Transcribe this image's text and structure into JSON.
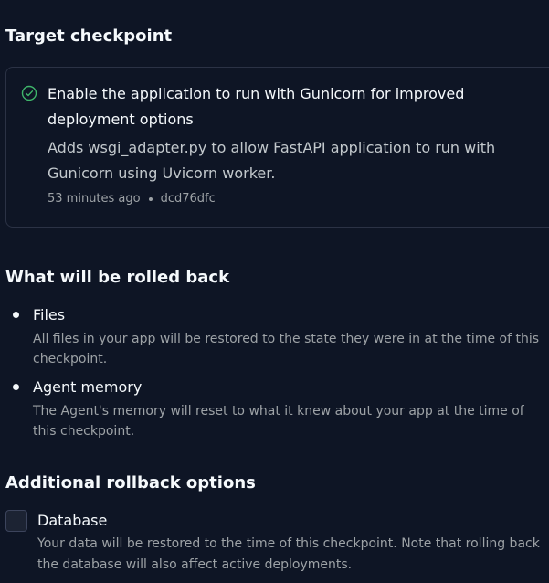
{
  "target": {
    "heading": "Target checkpoint",
    "checkpoint": {
      "title": "Enable the application to run with Gunicorn for improved deployment options",
      "description": "Adds wsgi_adapter.py to allow FastAPI application to run with Gunicorn using Uvicorn worker.",
      "time_ago": "53 minutes ago",
      "commit": "dcd76dfc",
      "icon": "check-circle-icon",
      "status_color": "#3fb56b"
    }
  },
  "rollback": {
    "heading": "What will be rolled back",
    "items": [
      {
        "title": "Files",
        "description": "All files in your app will be restored to the state they were in at the time of this checkpoint."
      },
      {
        "title": "Agent memory",
        "description": "The Agent's memory will reset to what it knew about your app at the time of this checkpoint."
      }
    ]
  },
  "additional": {
    "heading": "Additional rollback options",
    "options": [
      {
        "label": "Database",
        "checked": false,
        "description": "Your data will be restored to the time of this checkpoint. Note that rolling back the database will also affect active deployments."
      }
    ]
  },
  "colors": {
    "background": "#0e1525",
    "text_primary": "#f5f9fc",
    "text_secondary": "#9da2a6",
    "border": "#2b3245"
  }
}
